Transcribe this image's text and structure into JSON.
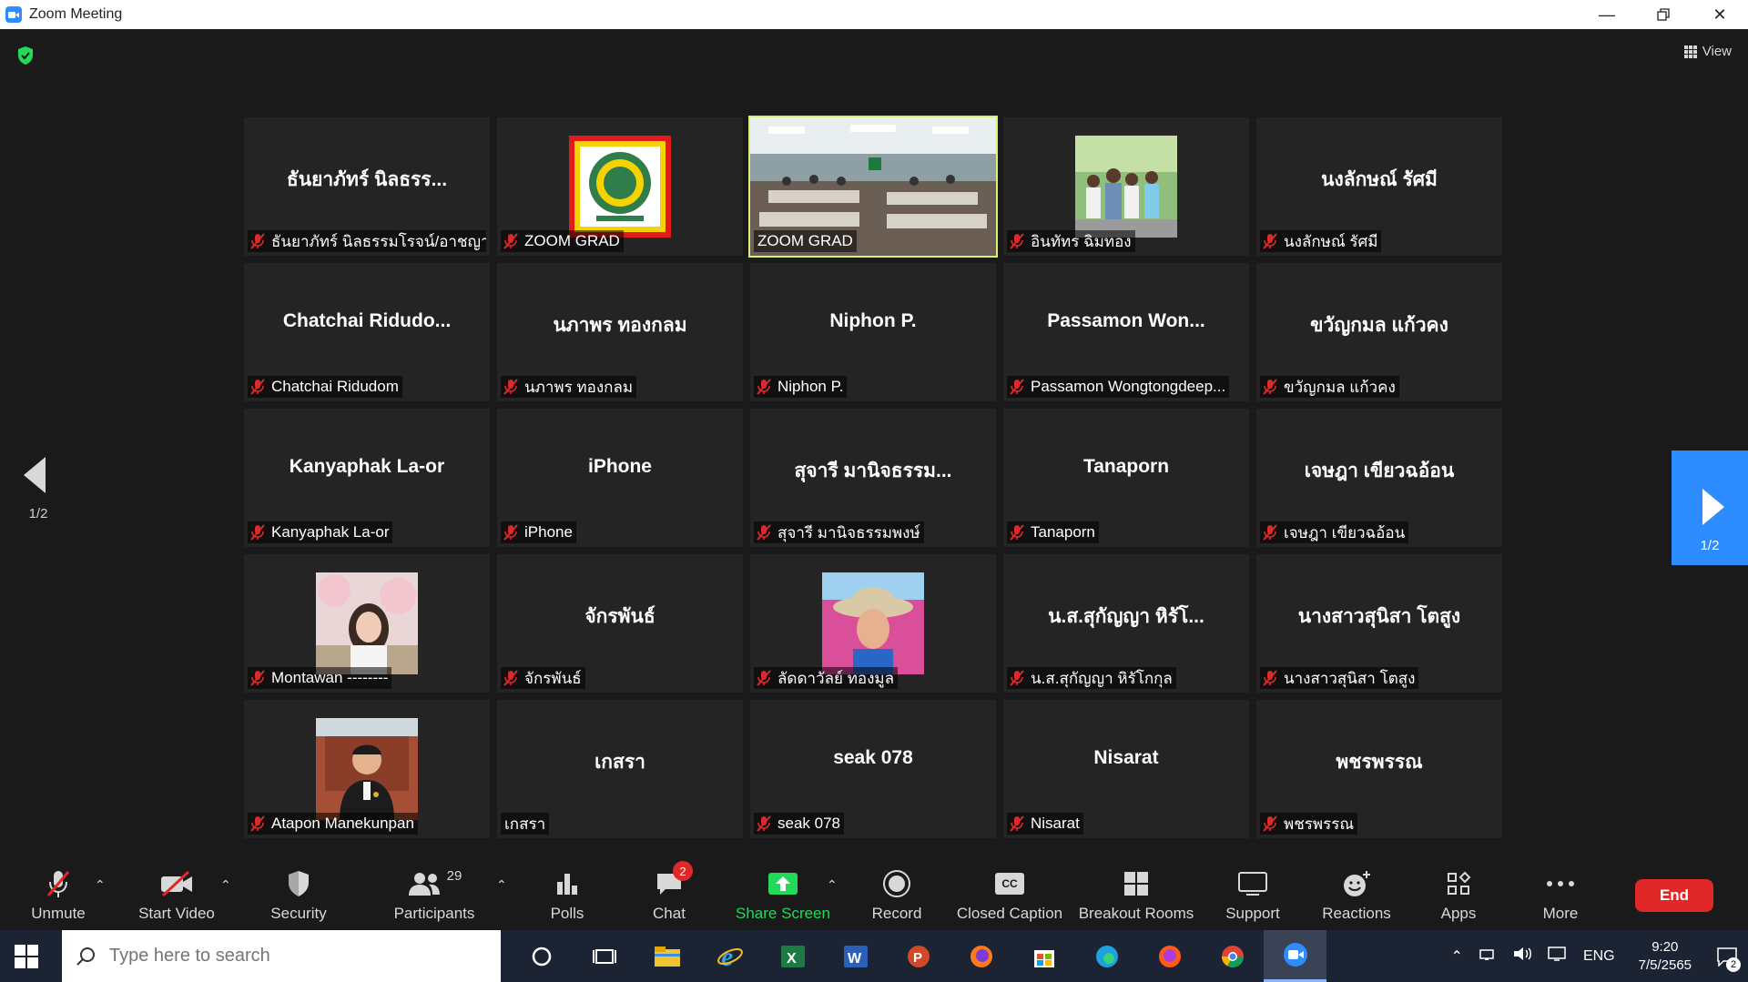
{
  "window": {
    "title": "Zoom Meeting"
  },
  "view_button": {
    "label": "View"
  },
  "pagination": {
    "left": "1/2",
    "right": "1/2"
  },
  "tiles": [
    {
      "name": "ธันยาภัทร์ นิลธรร...",
      "label": "ธันยาภัทร์ นิลธรรมโรจน์/อาชญา",
      "muted": true,
      "pic": ""
    },
    {
      "name": "",
      "label": "ZOOM GRAD",
      "muted": true,
      "pic": "logo"
    },
    {
      "name": "",
      "label": "ZOOM GRAD",
      "muted": false,
      "pic": "classroom",
      "speaking": true
    },
    {
      "name": "",
      "label": "อินทัทร ฉิมทอง",
      "muted": true,
      "pic": "kids"
    },
    {
      "name": "นงลักษณ์ รัศมี",
      "label": "นงลักษณ์ รัศมี",
      "muted": true,
      "pic": ""
    },
    {
      "name": "Chatchai  Ridudo...",
      "label": "Chatchai Ridudom",
      "muted": true,
      "pic": ""
    },
    {
      "name": "นภาพร ทองกลม",
      "label": "นภาพร ทองกลม",
      "muted": true,
      "pic": ""
    },
    {
      "name": "Niphon P.",
      "label": "Niphon P.",
      "muted": true,
      "pic": ""
    },
    {
      "name": "Passamon  Won...",
      "label": "Passamon Wongtongdeep...",
      "muted": true,
      "pic": ""
    },
    {
      "name": "ขวัญกมล แก้วคง",
      "label": "ขวัญกมล แก้วคง",
      "muted": true,
      "pic": ""
    },
    {
      "name": "Kanyaphak La-or",
      "label": "Kanyaphak La-or",
      "muted": true,
      "pic": ""
    },
    {
      "name": "iPhone",
      "label": "iPhone",
      "muted": true,
      "pic": ""
    },
    {
      "name": "สุจารี  มานิจธรรม...",
      "label": "สุจารี  มานิจธรรมพงษ์",
      "muted": true,
      "pic": ""
    },
    {
      "name": "Tanaporn",
      "label": "Tanaporn",
      "muted": true,
      "pic": ""
    },
    {
      "name": "เจษฎา เขียวฉอ้อน",
      "label": "เจษฎา เขียวฉอ้อน",
      "muted": true,
      "pic": ""
    },
    {
      "name": "",
      "label": "Montawan --------",
      "muted": true,
      "pic": "woman"
    },
    {
      "name": "จักรพันธ์",
      "label": "จักรพันธ์",
      "muted": true,
      "pic": ""
    },
    {
      "name": "",
      "label": "ลัดดาวัลย์ ทองมูล",
      "muted": true,
      "pic": "hat"
    },
    {
      "name": "น.ส.สุกัญญา หิรัโ...",
      "label": "น.ส.สุกัญญา หิรัโกกุล",
      "muted": true,
      "pic": ""
    },
    {
      "name": "นางสาวสุนิสา  โตสูง",
      "label": "นางสาวสุนิสา  โตสูง",
      "muted": true,
      "pic": ""
    },
    {
      "name": "",
      "label": "Atapon Manekunpan",
      "muted": true,
      "pic": "man"
    },
    {
      "name": "เกสรา",
      "label": "เกสรา",
      "muted": false,
      "pic": ""
    },
    {
      "name": "seak 078",
      "label": "seak 078",
      "muted": true,
      "pic": ""
    },
    {
      "name": "Nisarat",
      "label": "Nisarat",
      "muted": true,
      "pic": ""
    },
    {
      "name": "พชรพรรณ",
      "label": "พชรพรรณ",
      "muted": true,
      "pic": ""
    }
  ],
  "toolbar": {
    "unmute": "Unmute",
    "start_video": "Start Video",
    "security": "Security",
    "participants": "Participants",
    "participants_count": "29",
    "polls": "Polls",
    "chat": "Chat",
    "chat_badge": "2",
    "share_screen": "Share Screen",
    "record": "Record",
    "closed_caption": "Closed Caption",
    "cc_glyph": "CC",
    "breakout_rooms": "Breakout Rooms",
    "support": "Support",
    "reactions": "Reactions",
    "apps": "Apps",
    "more": "More",
    "end": "End"
  },
  "taskbar": {
    "search_placeholder": "Type here to search",
    "language": "ENG",
    "time": "9:20",
    "date": "7/5/2565",
    "notification_count": "2"
  },
  "colors": {
    "accent": "#2D8CFF",
    "end_red": "#E02828",
    "share_green": "#23D959",
    "speaking_outline": "#D8F07A"
  }
}
